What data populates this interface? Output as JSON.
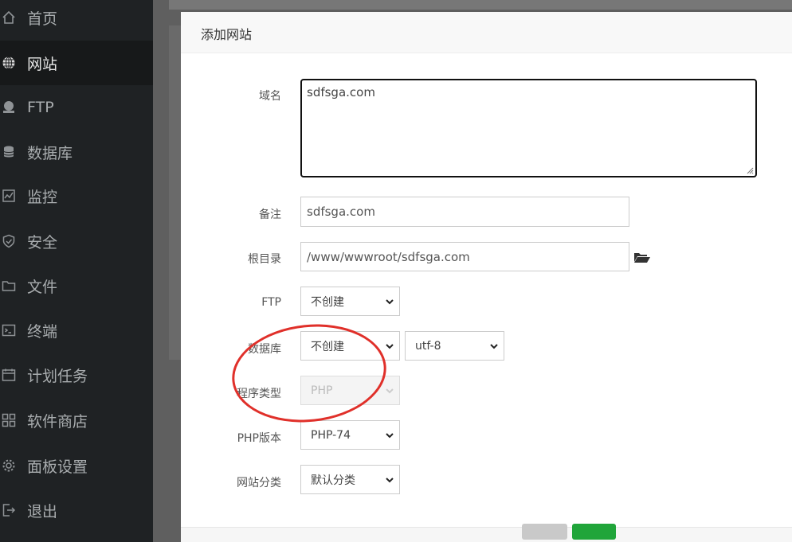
{
  "sidebar": {
    "items": [
      {
        "label": "首页",
        "icon": "home-icon"
      },
      {
        "label": "网站",
        "icon": "globe-icon",
        "active": true
      },
      {
        "label": "FTP",
        "icon": "ftp-icon"
      },
      {
        "label": "数据库",
        "icon": "database-icon"
      },
      {
        "label": "监控",
        "icon": "monitor-icon"
      },
      {
        "label": "安全",
        "icon": "shield-icon"
      },
      {
        "label": "文件",
        "icon": "folder-icon"
      },
      {
        "label": "终端",
        "icon": "terminal-icon"
      },
      {
        "label": "计划任务",
        "icon": "calendar-icon"
      },
      {
        "label": "软件商店",
        "icon": "apps-icon"
      },
      {
        "label": "面板设置",
        "icon": "gear-icon"
      },
      {
        "label": "退出",
        "icon": "logout-icon"
      }
    ]
  },
  "dialog": {
    "title": "添加网站",
    "form": {
      "domain_label": "域名",
      "domain_value": "sdfsga.com",
      "remark_label": "备注",
      "remark_value": "sdfsga.com",
      "root_label": "根目录",
      "root_value": "/www/wwwroot/sdfsga.com",
      "ftp_label": "FTP",
      "ftp_value": "不创建",
      "db_label": "数据库",
      "db_value": "不创建",
      "db_charset": "utf-8",
      "type_label": "程序类型",
      "type_value": "PHP",
      "php_label": "PHP版本",
      "php_value": "PHP-74",
      "category_label": "网站分类",
      "category_value": "默认分类"
    }
  },
  "colors": {
    "sidebar_bg": "#1f2224",
    "accent": "#20a53a",
    "annotation": "#e0302a"
  }
}
